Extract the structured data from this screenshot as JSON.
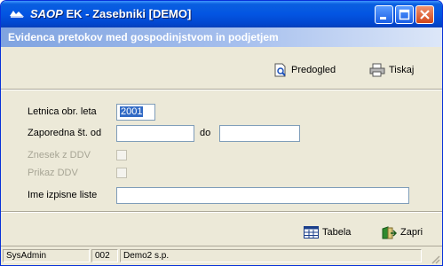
{
  "window": {
    "title_brand": "SAOP",
    "title_rest": "EK - Zasebniki [DEMO]"
  },
  "subheader": {
    "text": "Evidenca pretokov med gospodinjstvom in podjetjem"
  },
  "toolbar": {
    "preview_label": "Predogled",
    "print_label": "Tiskaj"
  },
  "form": {
    "year_label": "Letnica obr. leta",
    "year_value": "2001",
    "seq_label": "Zaporedna št. od",
    "seq_from": "",
    "to_label": "do",
    "seq_to": "",
    "vat_amount_label": "Znesek z DDV",
    "vat_show_label": "Prikaz DDV",
    "list_name_label": "Ime izpisne liste",
    "list_name_value": ""
  },
  "actions": {
    "table_label": "Tabela",
    "close_label": "Zapri"
  },
  "statusbar": {
    "user": "SysAdmin",
    "code": "002",
    "company": "Demo2 s.p."
  }
}
